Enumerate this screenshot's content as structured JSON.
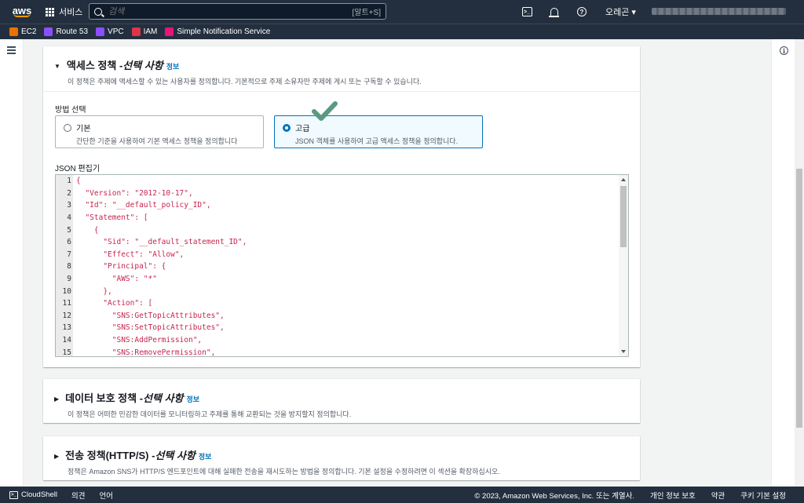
{
  "topnav": {
    "logo": "aws",
    "services_label": "서비스",
    "search_placeholder": "검색",
    "search_shortcut": "[알트+S]",
    "region_label": "오레곤 ▾"
  },
  "favorites": [
    {
      "label": "EC2",
      "color": "#ed7100"
    },
    {
      "label": "Route 53",
      "color": "#8c4fff"
    },
    {
      "label": "VPC",
      "color": "#8c4fff"
    },
    {
      "label": "IAM",
      "color": "#dd344c"
    },
    {
      "label": "Simple Notification Service",
      "color": "#e7157b"
    }
  ],
  "access_policy": {
    "title_main": "액세스 정책 - ",
    "title_em": "선택 사항",
    "info": "정보",
    "desc": "이 정책은 주제에 액세스할 수 있는 사용자를 정의합니다. 기본적으로 주제 소유자만 주제에 게시 또는 구독할 수 있습니다.",
    "method_label": "방법 선택",
    "basic_title": "기본",
    "basic_desc": "간단한 기준을 사용하여 기본 액세스 정책을 정의합니다",
    "advanced_title": "고급",
    "advanced_desc": "JSON 객체를 사용하여 고급 액세스 정책을 정의합니다.",
    "editor_label": "JSON 편집기",
    "selected_option": "advanced"
  },
  "json_lines": [
    {
      "n": "1",
      "t": "{"
    },
    {
      "n": "2",
      "t": "  \"Version\": \"2012-10-17\","
    },
    {
      "n": "3",
      "t": "  \"Id\": \"__default_policy_ID\","
    },
    {
      "n": "4",
      "t": "  \"Statement\": ["
    },
    {
      "n": "5",
      "t": "    {"
    },
    {
      "n": "6",
      "t": "      \"Sid\": \"__default_statement_ID\","
    },
    {
      "n": "7",
      "t": "      \"Effect\": \"Allow\","
    },
    {
      "n": "8",
      "t": "      \"Principal\": {"
    },
    {
      "n": "9",
      "t": "        \"AWS\": \"*\""
    },
    {
      "n": "10",
      "t": "      },"
    },
    {
      "n": "11",
      "t": "      \"Action\": ["
    },
    {
      "n": "12",
      "t": "        \"SNS:GetTopicAttributes\","
    },
    {
      "n": "13",
      "t": "        \"SNS:SetTopicAttributes\","
    },
    {
      "n": "14",
      "t": "        \"SNS:AddPermission\","
    },
    {
      "n": "15",
      "t": "        \"SNS:RemovePermission\","
    }
  ],
  "data_protection": {
    "title_main": "데이터 보호 정책 - ",
    "title_em": "선택 사항",
    "info": "정보",
    "desc": "이 정책은 어떠한 민감한 데이터를 모니터링하고 주제를 통해 교환되는 것을 방지할지 정의합니다."
  },
  "delivery_policy": {
    "title_main": "전송 정책(HTTP/S) - ",
    "title_em": "선택 사항",
    "info": "정보",
    "desc": "정책은 Amazon SNS가 HTTP/S 엔드포인트에 대해 실패한 전송을 재시도하는 방법을 정의합니다. 기본 설정을 수정하려면 이 섹션을 확장하십시오."
  },
  "footer": {
    "cloudshell": "CloudShell",
    "feedback": "의견",
    "language": "언어",
    "copyright": "© 2023, Amazon Web Services, Inc. 또는 계열사.",
    "privacy": "개인 정보 보호",
    "terms": "약관",
    "cookies": "쿠키 기본 설정"
  },
  "colors": {
    "nav_bg": "#232f3e",
    "link": "#0073bb",
    "checkmark": "#5a9a80"
  }
}
